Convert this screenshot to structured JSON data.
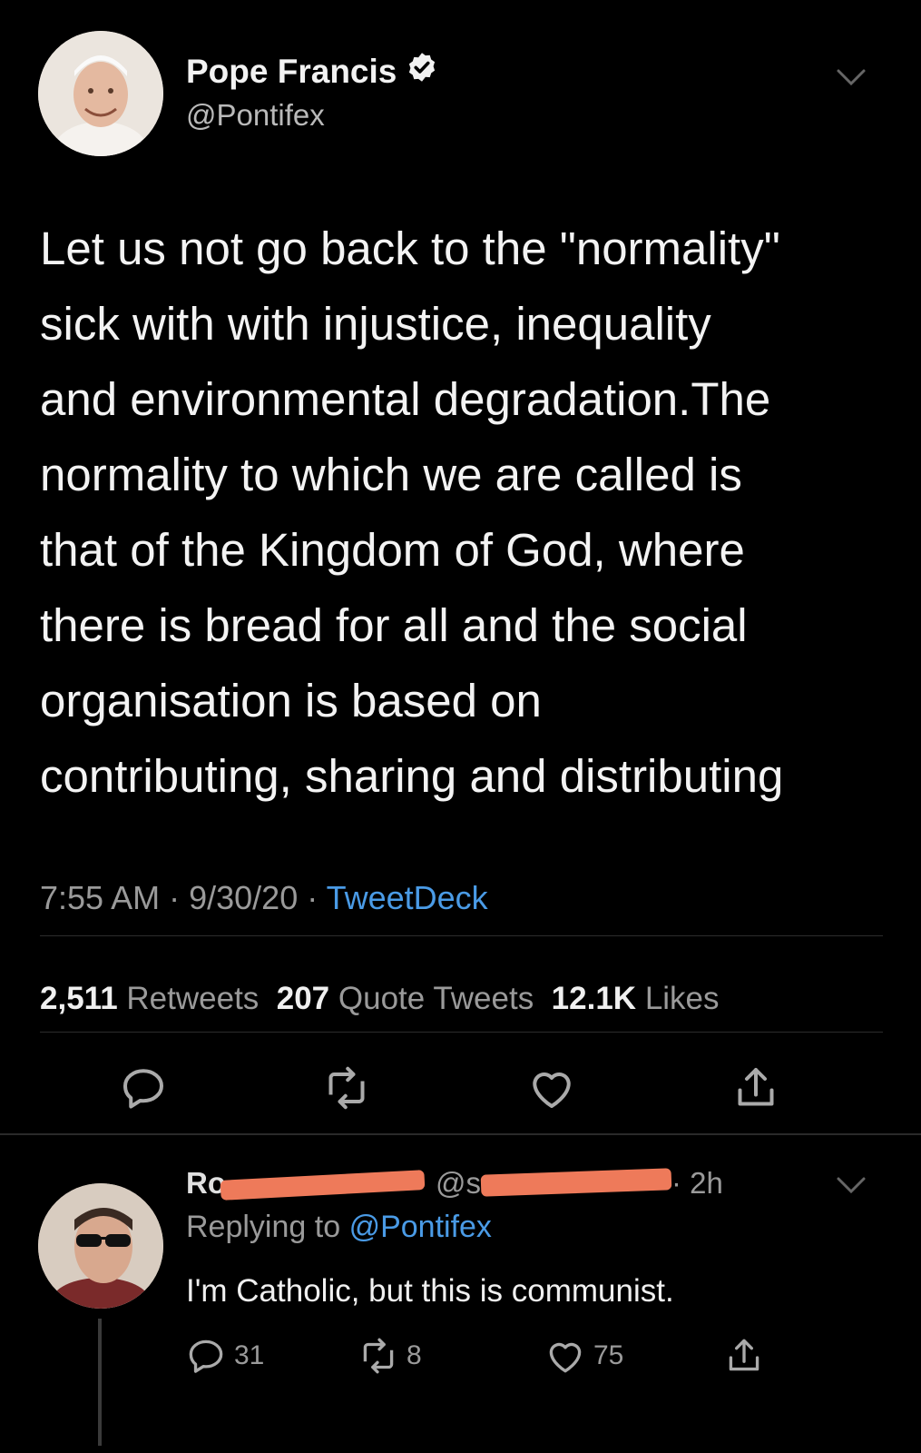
{
  "tweet": {
    "author_name": "Pope Francis",
    "author_handle": "@Pontifex",
    "verified": true,
    "body_lines": [
      "Let us not go back to the \"normality\"",
      "sick with with injustice, inequality",
      "and environmental degradation.The",
      "normality to which we are called is",
      "that of the Kingdom of God, where",
      "there is bread for all and the social",
      "organisation is based on",
      "contributing, sharing and distributing"
    ],
    "time": "7:55 AM",
    "date": "9/30/20",
    "source": "TweetDeck",
    "retweets_count": "2,511",
    "retweets_label": "Retweets",
    "quotes_count": "207",
    "quotes_label": "Quote Tweets",
    "likes_count": "12.1K",
    "likes_label": "Likes"
  },
  "reply": {
    "name_visible": "Ro",
    "handle_visible": "@s",
    "time": "· 2h",
    "replying_to_label": "Replying to",
    "replying_to_handle": "@Pontifex",
    "text": "I'm Catholic, but this is communist.",
    "reply_count": "31",
    "retweet_count": "8",
    "like_count": "75"
  },
  "colors": {
    "background": "#000000",
    "link": "#4a9be6",
    "secondary_text": "#9a9a9a",
    "redaction": "#ee7a5a"
  },
  "icons": [
    "verified-badge-icon",
    "chevron-down-icon",
    "reply-icon",
    "retweet-icon",
    "like-icon",
    "share-icon"
  ]
}
